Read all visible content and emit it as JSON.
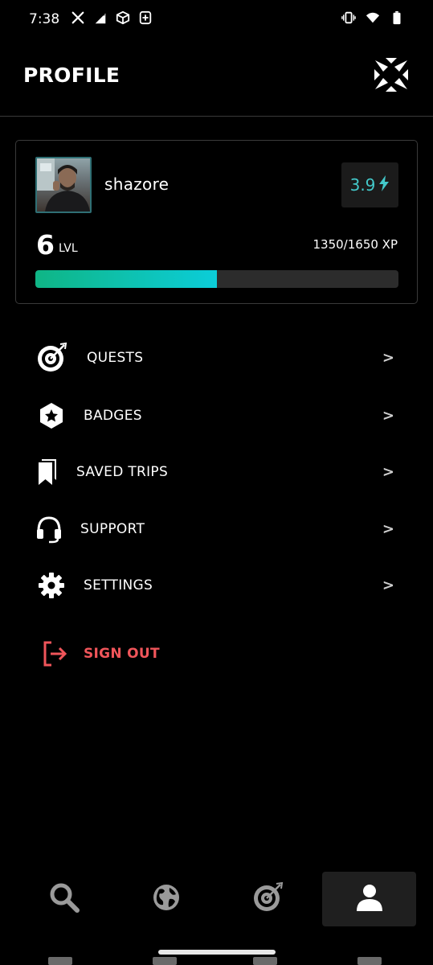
{
  "status_bar": {
    "time": "7:38",
    "left_icons": [
      "x-logo-icon",
      "signal-alert-icon",
      "cube-app-icon",
      "plus-square-icon"
    ],
    "right_icons": [
      "vibrate-icon",
      "wifi-icon",
      "battery-icon"
    ]
  },
  "header": {
    "title": "PROFILE",
    "logo_icon": "app-logo-icon"
  },
  "profile": {
    "username": "shazore",
    "rating": "3.9",
    "rating_icon": "lightning-icon",
    "level": "6",
    "level_label": "LVL",
    "xp_text": "1350/1650 XP",
    "xp_progress": 0.5,
    "accent_colors": {
      "progress_start": "#0fb585",
      "progress_end": "#0ccdd9",
      "rating": "#43c8c9"
    }
  },
  "menu": {
    "items": [
      {
        "label": "QUESTS",
        "icon": "target-icon",
        "chevron": ">"
      },
      {
        "label": "BADGES",
        "icon": "badge-star-icon",
        "chevron": ">"
      },
      {
        "label": "SAVED TRIPS",
        "icon": "bookmarks-icon",
        "chevron": ">"
      },
      {
        "label": "SUPPORT",
        "icon": "headset-icon",
        "chevron": ">"
      },
      {
        "label": "SETTINGS",
        "icon": "gear-icon",
        "chevron": ">"
      }
    ],
    "sign_out": {
      "label": "SIGN OUT",
      "icon": "sign-out-icon",
      "color": "#f0555a"
    }
  },
  "bottom_nav": {
    "items": [
      {
        "icon": "search-icon",
        "active": false
      },
      {
        "icon": "globe-icon",
        "active": false
      },
      {
        "icon": "target-icon",
        "active": false
      },
      {
        "icon": "user-icon",
        "active": true
      }
    ]
  }
}
